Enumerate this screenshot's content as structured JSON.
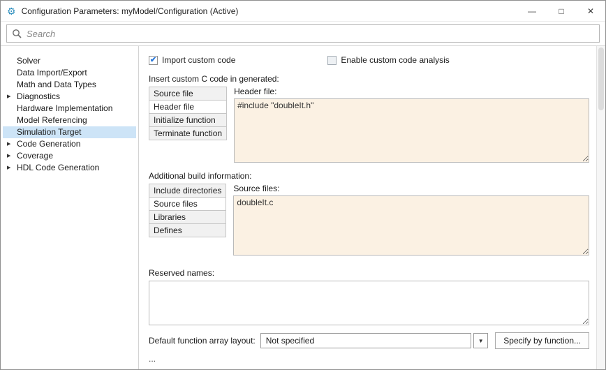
{
  "window": {
    "title": "Configuration Parameters: myModel/Configuration (Active)",
    "controls": {
      "minimize": "—",
      "maximize": "□",
      "close": "✕"
    }
  },
  "search": {
    "placeholder": "Search"
  },
  "sidebar": {
    "items": [
      {
        "label": "Solver",
        "expandable": false,
        "selected": false
      },
      {
        "label": "Data Import/Export",
        "expandable": false,
        "selected": false
      },
      {
        "label": "Math and Data Types",
        "expandable": false,
        "selected": false
      },
      {
        "label": "Diagnostics",
        "expandable": true,
        "selected": false
      },
      {
        "label": "Hardware Implementation",
        "expandable": false,
        "selected": false
      },
      {
        "label": "Model Referencing",
        "expandable": false,
        "selected": false
      },
      {
        "label": "Simulation Target",
        "expandable": false,
        "selected": true
      },
      {
        "label": "Code Generation",
        "expandable": true,
        "selected": false
      },
      {
        "label": "Coverage",
        "expandable": true,
        "selected": false
      },
      {
        "label": "HDL Code Generation",
        "expandable": true,
        "selected": false
      }
    ]
  },
  "main": {
    "import_custom_code": {
      "label": "Import custom code",
      "checked": true
    },
    "enable_custom_code_analysis": {
      "label": "Enable custom code analysis",
      "checked": false
    },
    "insert_section": {
      "label": "Insert custom C code in generated:",
      "tabs": [
        {
          "label": "Source file",
          "selected": false
        },
        {
          "label": "Header file",
          "selected": true
        },
        {
          "label": "Initialize function",
          "selected": false
        },
        {
          "label": "Terminate function",
          "selected": false
        }
      ],
      "field_label": "Header file:",
      "field_value": "#include \"doubleIt.h\""
    },
    "build_section": {
      "label": "Additional build information:",
      "tabs": [
        {
          "label": "Include directories",
          "selected": false
        },
        {
          "label": "Source files",
          "selected": true
        },
        {
          "label": "Libraries",
          "selected": false
        },
        {
          "label": "Defines",
          "selected": false
        }
      ],
      "field_label": "Source files:",
      "field_value": "doubleIt.c"
    },
    "reserved_names": {
      "label": "Reserved names:",
      "value": ""
    },
    "function_array_layout": {
      "label": "Default function array layout:",
      "value": "Not specified",
      "button_label": "Specify by function..."
    },
    "more_indicator": "..."
  },
  "colors": {
    "selected_sidebar_item_bg": "#cde4f7",
    "prefilled_field_bg": "#fbf1e3",
    "checkbox_check": "#2676d9"
  }
}
